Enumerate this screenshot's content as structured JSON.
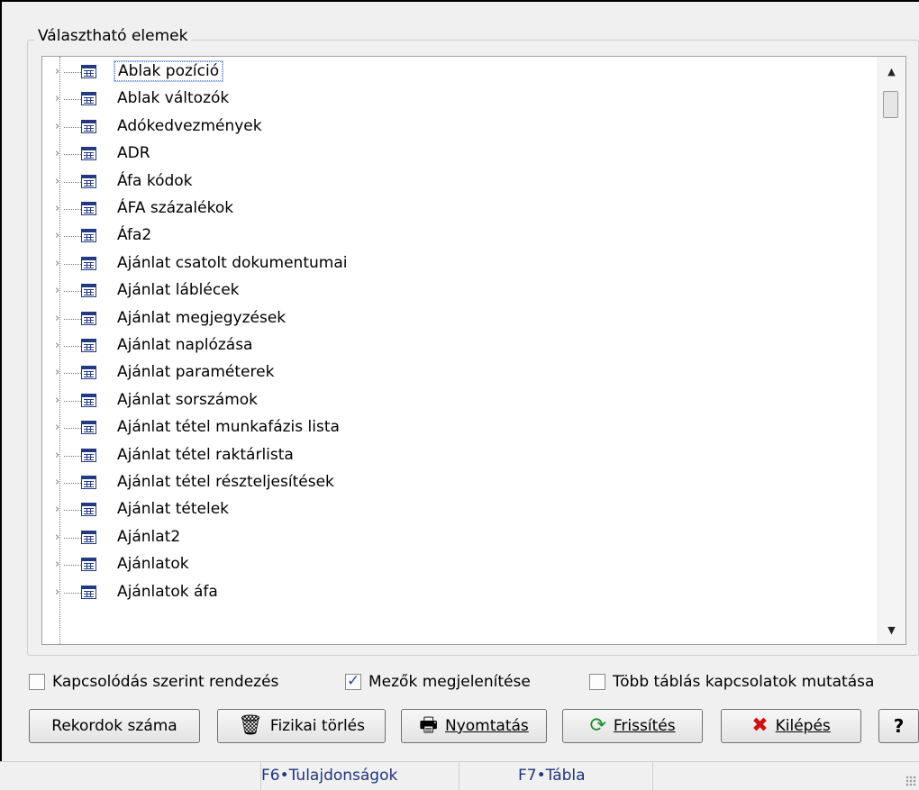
{
  "group_title": "Választható elemek",
  "tree_items": [
    "Ablak pozíció",
    "Ablak változók",
    "Adókedvezmények",
    "ADR",
    "Áfa kódok",
    "ÁFA százalékok",
    "Áfa2",
    "Ajánlat csatolt dokumentumai",
    "Ajánlat láblécek",
    "Ajánlat megjegyzések",
    "Ajánlat naplózása",
    "Ajánlat paraméterek",
    "Ajánlat sorszámok",
    "Ajánlat tétel munkafázis lista",
    "Ajánlat tétel raktárlista",
    "Ajánlat tétel részteljesítések",
    "Ajánlat tételek",
    "Ajánlat2",
    "Ajánlatok",
    "Ajánlatok áfa"
  ],
  "selected_index": 0,
  "checkboxes": {
    "sort_by_relation": {
      "label": "Kapcsolódás szerint rendezés",
      "checked": false
    },
    "show_fields": {
      "label": "Mezők megjelenítése",
      "checked": true
    },
    "multi_table": {
      "label": "Több táblás kapcsolatok mutatása",
      "checked": false
    }
  },
  "buttons": {
    "record_count": "Rekordok száma",
    "physical_delete": "Fizikai törlés",
    "print": "Nyomtatás",
    "refresh": "Frissítés",
    "exit": "Kilépés",
    "help": "?"
  },
  "statusbar": {
    "f6": "F6•Tulajdonságok",
    "f7": "F7•Tábla"
  },
  "icons": {
    "table": "table-icon",
    "trash": "trash-icon",
    "printer": "printer-icon",
    "refresh": "refresh-icon",
    "exit": "red-x-icon",
    "expander": "chevron-right-icon"
  }
}
